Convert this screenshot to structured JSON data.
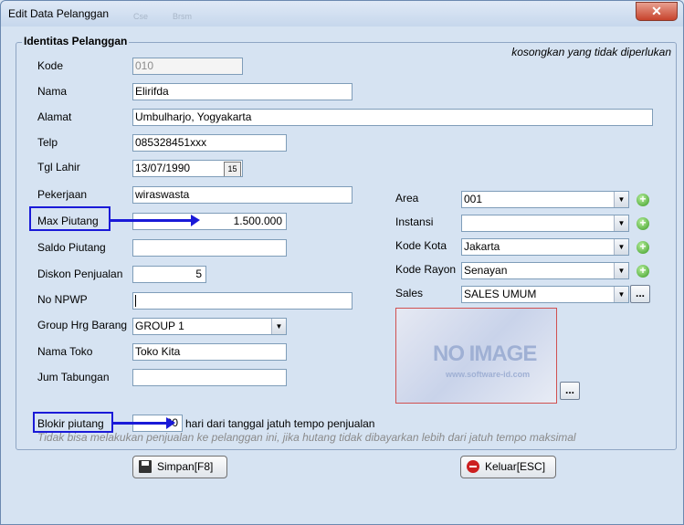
{
  "window": {
    "title": "Edit Data Pelanggan",
    "close_label": "✕",
    "ghost_labels": [
      "Cse",
      "Brsm"
    ]
  },
  "group": {
    "title": "Identitas Pelanggan",
    "hint": "kosongkan yang tidak diperlukan"
  },
  "left_fields": {
    "kode": {
      "label": "Kode",
      "value": "010"
    },
    "nama": {
      "label": "Nama",
      "value": "Elirifda"
    },
    "alamat": {
      "label": "Alamat",
      "value": "Umbulharjo, Yogyakarta"
    },
    "telp": {
      "label": "Telp",
      "value": "085328451xxx"
    },
    "tgl_lahir": {
      "label": "Tgl Lahir",
      "value": "13/07/1990",
      "button": "15"
    },
    "pekerjaan": {
      "label": "Pekerjaan",
      "value": "wiraswasta"
    },
    "max_piutang": {
      "label": "Max Piutang",
      "value": "1.500.000"
    },
    "saldo_piutang": {
      "label": "Saldo Piutang",
      "value": ""
    },
    "diskon": {
      "label": "Diskon Penjualan",
      "value": "5"
    },
    "npwp": {
      "label": "No NPWP",
      "value": ""
    },
    "group_hrg": {
      "label": "Group Hrg Barang",
      "value": "GROUP 1"
    },
    "nama_toko": {
      "label": "Nama Toko",
      "value": "Toko Kita"
    },
    "jum_tabungan": {
      "label": "Jum Tabungan",
      "value": ""
    }
  },
  "right_fields": {
    "area": {
      "label": "Area",
      "value": "001"
    },
    "instansi": {
      "label": "Instansi",
      "value": ""
    },
    "kode_kota": {
      "label": "Kode Kota",
      "value": "Jakarta"
    },
    "kode_rayon": {
      "label": "Kode Rayon",
      "value": "Senayan"
    },
    "sales": {
      "label": "Sales",
      "value": "SALES UMUM"
    },
    "dots": "..."
  },
  "image": {
    "text": "NO IMAGE",
    "sub": "www.software-id.com",
    "dots": "..."
  },
  "blokir": {
    "label": "Blokir piutang",
    "value": "30",
    "suffix": "hari dari tanggal jatuh tempo penjualan",
    "note": "Tidak bisa melakukan penjualan ke pelanggan ini, jika hutang tidak dibayarkan lebih dari jatuh tempo maksimal"
  },
  "buttons": {
    "save": "Simpan[F8]",
    "exit": "Keluar[ESC]"
  },
  "icons": {
    "plus": "+",
    "arrow_down": "▼"
  },
  "colors": {
    "highlight": "#1a1ad8",
    "window_bg": "#d6e3f2"
  }
}
